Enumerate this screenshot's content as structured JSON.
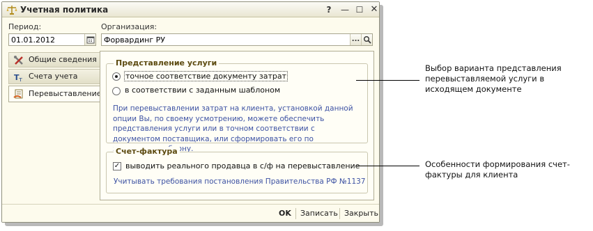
{
  "window": {
    "title": "Учетная политика",
    "help_glyph": "?",
    "min_glyph": "—",
    "max_glyph": "☐",
    "close_glyph": "✕"
  },
  "period": {
    "label": "Период:",
    "value": "01.01.2012"
  },
  "organization": {
    "label": "Организация:",
    "value": "Форвардинг РУ",
    "select_glyph": "...",
    "search_glyph": "🔍"
  },
  "tabs": [
    {
      "label": "Общие сведения",
      "icon": "tools-icon"
    },
    {
      "label": "Счета учета",
      "icon": "accounts-icon"
    },
    {
      "label": "Перевыставление",
      "icon": "reinvoice-icon",
      "active": true
    }
  ],
  "service_group": {
    "title": "Представление услуги",
    "options": [
      {
        "label": "точное соответствие документу затрат",
        "selected": true
      },
      {
        "label": "в соответствии с заданным шаблоном",
        "selected": false
      }
    ],
    "hint": "При перевыставлении затрат на клиента, установкой данной опции Вы, по своему усмотрению, можете обеспечить представления услуги или в точном соответствии с документом поставщика, или  сформировать его по заданному шаблону."
  },
  "invoice_group": {
    "title": "Счет-фактура",
    "checkbox_label": "выводить реального продавца в с/ф на перевыставление",
    "checked": true,
    "check_glyph": "✓",
    "link": "Учитывать требования постановления Правительства РФ №1137"
  },
  "footer": {
    "ok": "OK",
    "save": "Записать",
    "close": "Закрыть"
  },
  "callouts": {
    "service": "Выбор варианта представления перевыставляемой услуги в исходящем документе",
    "invoice": "Особенности формирования счет-фактуры для клиента"
  }
}
